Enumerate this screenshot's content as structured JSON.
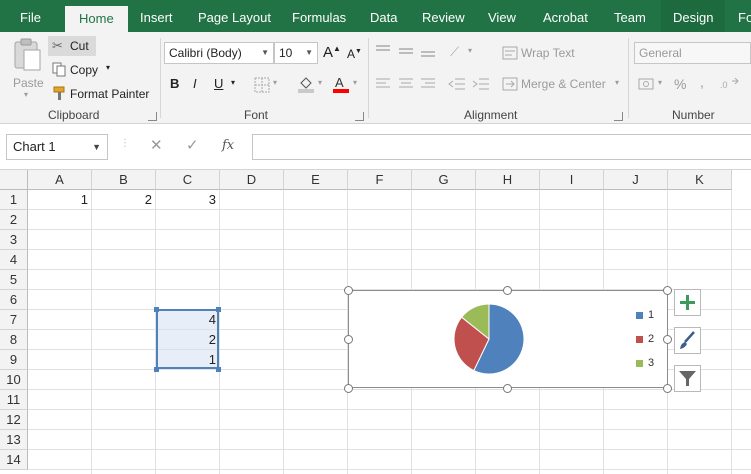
{
  "tabs": [
    "File",
    "Home",
    "Insert",
    "Page Layout",
    "Formulas",
    "Data",
    "Review",
    "View",
    "Acrobat",
    "Team",
    "Design",
    "Fo"
  ],
  "active_tab": "Home",
  "ribbon": {
    "clipboard": {
      "paste": "Paste",
      "cut": "Cut",
      "copy": "Copy",
      "format_painter": "Format Painter",
      "label": "Clipboard"
    },
    "font": {
      "family": "Calibri (Body)",
      "size": "10",
      "label": "Font",
      "bold": "B",
      "italic": "I",
      "underline": "U",
      "grow": "A",
      "shrink": "A"
    },
    "alignment": {
      "wrap_text": "Wrap Text",
      "merge_center": "Merge & Center",
      "label": "Alignment"
    },
    "number": {
      "format": "General",
      "percent": "%",
      "comma": ",",
      "label": "Number"
    }
  },
  "formula_bar": {
    "name_box": "Chart 1",
    "fx": "fx",
    "formula": ""
  },
  "grid": {
    "columns": [
      "A",
      "B",
      "C",
      "D",
      "E",
      "F",
      "G",
      "H",
      "I",
      "J",
      "K"
    ],
    "rows": [
      "1",
      "2",
      "3",
      "4",
      "5",
      "6",
      "7",
      "8",
      "9",
      "10",
      "11",
      "12",
      "13",
      "14"
    ],
    "cells": {
      "A1": "1",
      "B1": "2",
      "C1": "3",
      "C7": "4",
      "C8": "2",
      "C9": "1"
    }
  },
  "chart": {
    "chart_data": {
      "type": "pie",
      "categories": [
        "1",
        "2",
        "3"
      ],
      "values": [
        4,
        2,
        1
      ],
      "colors": [
        "#4f81bd",
        "#c0504d",
        "#9bbb59"
      ],
      "title": "",
      "legend": "right"
    }
  },
  "chart_tools": [
    "chart-elements",
    "chart-styles",
    "chart-filters"
  ],
  "colors": {
    "accent": "#217346",
    "selection": "#4f81bd",
    "font_color_bar": "#ff0000"
  }
}
